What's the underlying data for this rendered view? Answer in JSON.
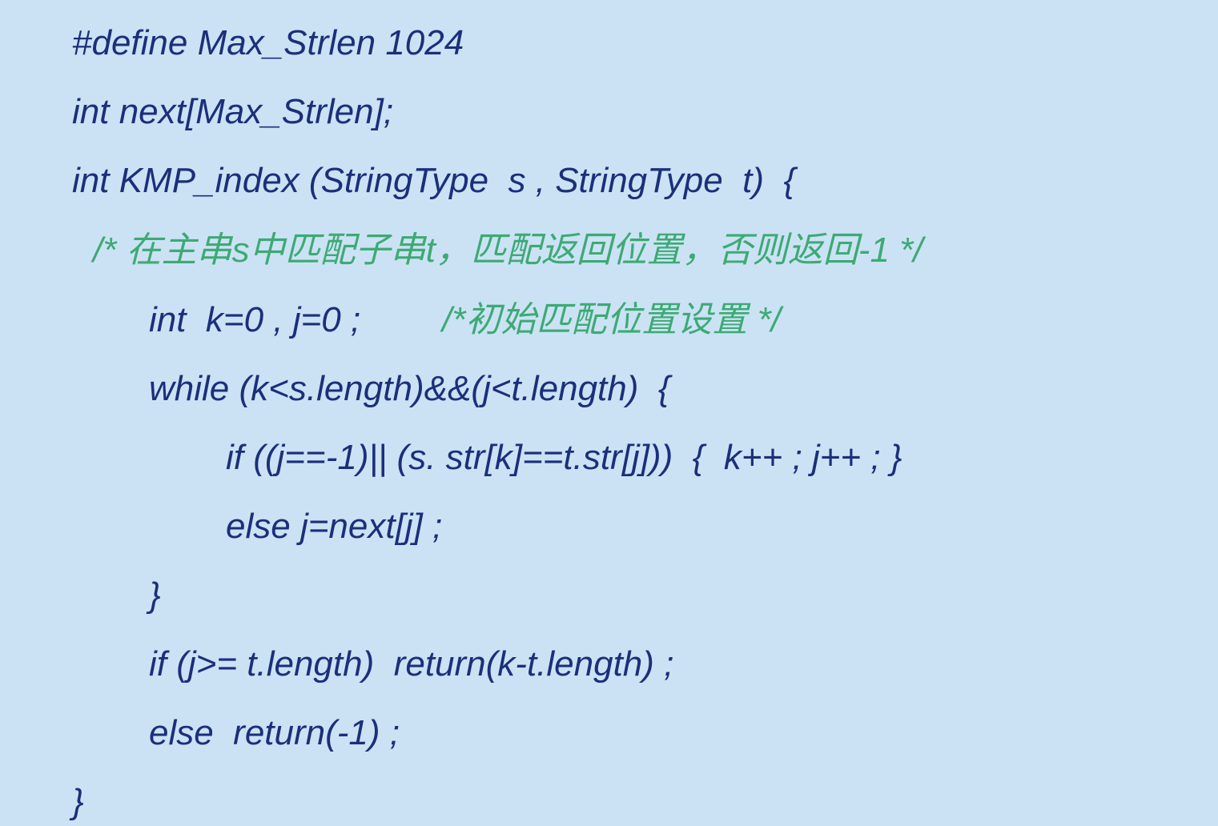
{
  "code": {
    "lines": [
      {
        "text": "#define Max_Strlen 1024"
      },
      {
        "text": "int next[Max_Strlen];"
      },
      {
        "text": "int KMP_index (StringType  s , StringType  t)  {"
      },
      {
        "text": "/* 在主串s中匹配子串t，匹配返回位置，否则返回-1 */"
      },
      {
        "text": "int  k=0 , j=0 ;",
        "comment": "/*初始匹配位置设置 */"
      },
      {
        "text": "while (k<s.length)&&(j<t.length)  {"
      },
      {
        "text": "if ((j==-1)|| (s. str[k]==t.str[j]))  {  k++ ; j++ ; }"
      },
      {
        "text": "else j=next[j] ;"
      },
      {
        "text": "}"
      },
      {
        "text": "if (j>= t.length)  return(k-t.length) ;"
      },
      {
        "text": "else  return(-1) ;"
      },
      {
        "text": "}"
      }
    ]
  },
  "colors": {
    "background": "#cbe2f5",
    "code_text": "#1b2f7a",
    "comment_text": "#3daa74"
  }
}
